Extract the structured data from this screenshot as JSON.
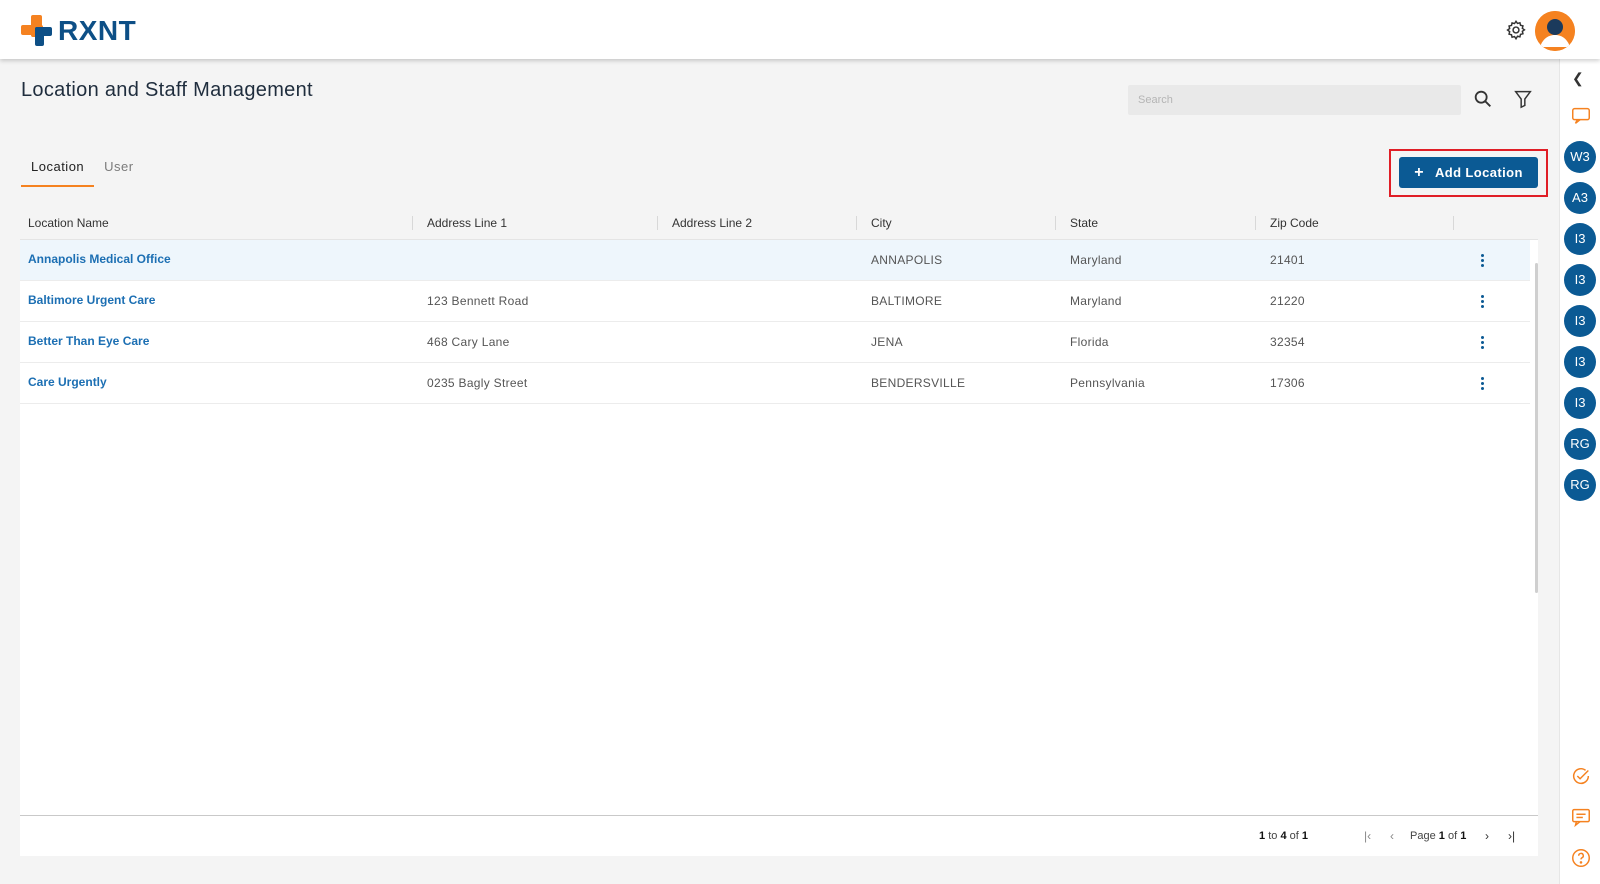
{
  "app": {
    "brand": "RXNT"
  },
  "page": {
    "title": "Location and Staff Management"
  },
  "search": {
    "placeholder": "Search"
  },
  "tabs": [
    {
      "label": "Location",
      "active": true
    },
    {
      "label": "User",
      "active": false
    }
  ],
  "actions": {
    "add_location_label": "Add Location",
    "add_icon": "+"
  },
  "table": {
    "columns": [
      "Location Name",
      "Address Line 1",
      "Address Line 2",
      "City",
      "State",
      "Zip Code"
    ],
    "rows": [
      {
        "name": "Annapolis Medical Office",
        "address1": "",
        "address2": "",
        "city": "ANNAPOLIS",
        "state": "Maryland",
        "zip": "21401"
      },
      {
        "name": "Baltimore Urgent Care",
        "address1": "123 Bennett Road",
        "address2": "",
        "city": "BALTIMORE",
        "state": "Maryland",
        "zip": "21220"
      },
      {
        "name": "Better Than Eye Care",
        "address1": "468 Cary Lane",
        "address2": "",
        "city": "JENA",
        "state": "Florida",
        "zip": "32354"
      },
      {
        "name": "Care Urgently",
        "address1": "0235 Bagly Street",
        "address2": "",
        "city": "BENDERSVILLE",
        "state": "Pennsylvania",
        "zip": "17306"
      }
    ]
  },
  "pagination": {
    "from": "1",
    "to_word": "to",
    "to": "4",
    "of_word": "of",
    "total": "1",
    "page_word": "Page",
    "page": "1",
    "page_of_word": "of",
    "page_total": "1"
  },
  "rail": {
    "bubbles": [
      "W3",
      "A3",
      "I3",
      "I3",
      "I3",
      "I3",
      "I3",
      "RG",
      "RG"
    ]
  },
  "colors": {
    "brand_blue": "#0b5a94",
    "accent_orange": "#f58220",
    "highlight_red": "#e01e26"
  },
  "icons": [
    "settings-gear-icon",
    "user-avatar-icon",
    "search-icon",
    "filter-icon",
    "kebab-menu-icon",
    "chat-icon",
    "check-circle-icon",
    "message-icon",
    "help-icon",
    "chevron-left-icon"
  ]
}
